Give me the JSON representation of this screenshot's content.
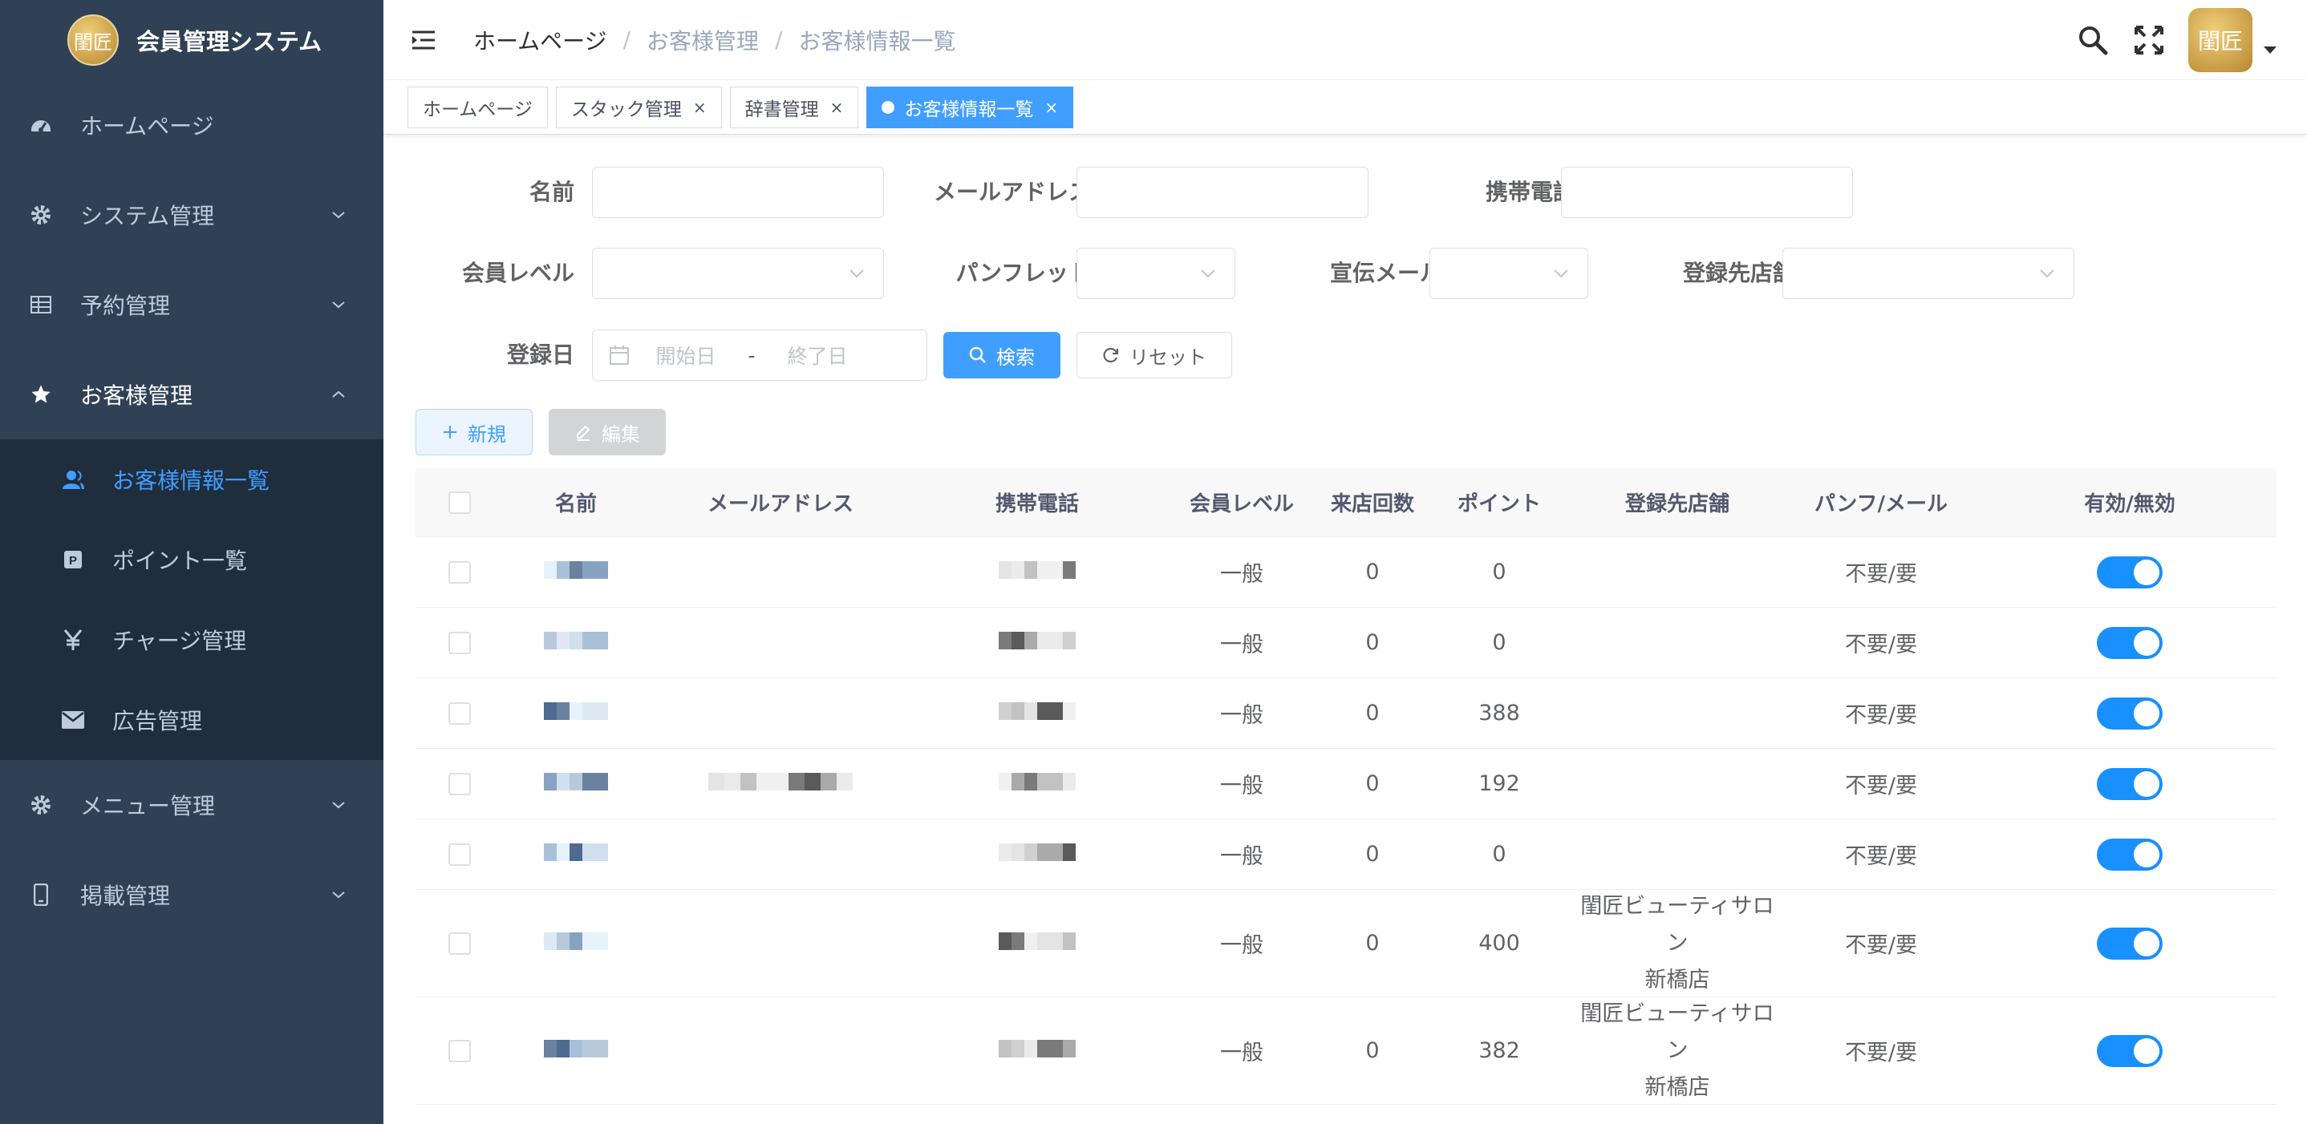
{
  "app": {
    "title": "会員管理システム",
    "logo_text": "閨匠"
  },
  "sidebar": {
    "items": [
      {
        "label": "ホームページ",
        "icon": "dashboard-icon"
      },
      {
        "label": "システム管理",
        "icon": "gear-icon"
      },
      {
        "label": "予約管理",
        "icon": "grid-icon"
      },
      {
        "label": "お客様管理",
        "icon": "star-icon"
      },
      {
        "label": "メニュー管理",
        "icon": "gear-icon"
      },
      {
        "label": "掲載管理",
        "icon": "phone-icon"
      }
    ],
    "subitems": [
      {
        "label": "お客様情報一覧",
        "icon": "user-icon"
      },
      {
        "label": "ポイント一覧",
        "icon": "point-icon"
      },
      {
        "label": "チャージ管理",
        "icon": "yen-icon"
      },
      {
        "label": "広告管理",
        "icon": "mail-icon"
      }
    ]
  },
  "navbar": {
    "breadcrumb": [
      "ホームページ",
      "お客様管理",
      "お客様情報一覧"
    ],
    "separator": "/"
  },
  "tags": [
    {
      "label": "ホームページ"
    },
    {
      "label": "スタック管理",
      "close": "×"
    },
    {
      "label": "辞書管理",
      "close": "×"
    },
    {
      "label": "お客様情報一覧",
      "close": "×"
    }
  ],
  "filters": {
    "name_label": "名前",
    "email_label": "メールアドレス",
    "phone_label": "携帯電話",
    "level_label": "会員レベル",
    "pamphlet_label": "パンフレット",
    "adv_mail_label": "宣伝メール",
    "store_label": "登録先店舗",
    "date_label": "登録日",
    "date_start": "開始日",
    "date_sep": "-",
    "date_end": "終了日"
  },
  "buttons": {
    "search": "検索",
    "reset": "リセット",
    "new": "新規",
    "edit": "編集"
  },
  "table": {
    "columns": [
      "名前",
      "メールアドレス",
      "携帯電話",
      "会員レベル",
      "来店回数",
      "ポイント",
      "登録先店舗",
      "パンフ/メール",
      "有効/無効"
    ],
    "rows": [
      {
        "level": "一般",
        "visits": "0",
        "points": "0",
        "store_1": "",
        "store_2": "",
        "pamph": "不要/要"
      },
      {
        "level": "一般",
        "visits": "0",
        "points": "0",
        "store_1": "",
        "store_2": "",
        "pamph": "不要/要"
      },
      {
        "level": "一般",
        "visits": "0",
        "points": "388",
        "store_1": "",
        "store_2": "",
        "pamph": "不要/要"
      },
      {
        "level": "一般",
        "visits": "0",
        "points": "192",
        "store_1": "",
        "store_2": "",
        "pamph": "不要/要"
      },
      {
        "level": "一般",
        "visits": "0",
        "points": "0",
        "store_1": "",
        "store_2": "",
        "pamph": "不要/要"
      },
      {
        "level": "一般",
        "visits": "0",
        "points": "400",
        "store_1": "閨匠ビューティサロン",
        "store_2": "新橋店",
        "pamph": "不要/要"
      },
      {
        "level": "一般",
        "visits": "0",
        "points": "382",
        "store_1": "閨匠ビューティサロン",
        "store_2": "新橋店",
        "pamph": "不要/要"
      }
    ]
  },
  "colors": {
    "sidebar_bg": "#304156",
    "submenu_bg": "#1f2d3d",
    "accent": "#409eff",
    "switch_on": "#1890ff"
  }
}
